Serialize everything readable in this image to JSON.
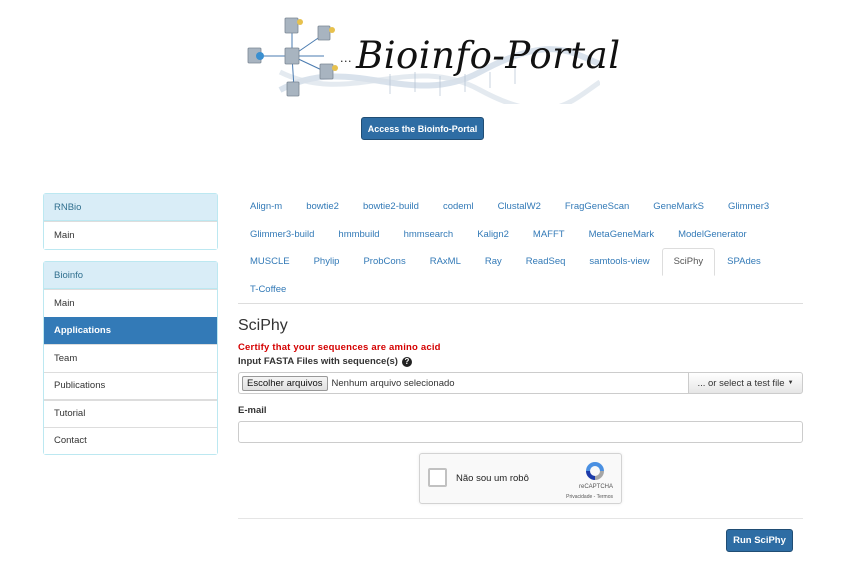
{
  "header": {
    "logo_text": "Bioinfo-Portal",
    "logo_ellipsis": "...",
    "access_button": "Access the Bioinfo-Portal"
  },
  "sidebar": {
    "rnbio": {
      "heading": "RNBio",
      "items": [
        "Main"
      ]
    },
    "bioinfo": {
      "heading": "Bioinfo",
      "items": [
        "Main",
        "Applications",
        "Team",
        "Publications",
        "Tutorial",
        "Contact"
      ],
      "active": "Applications"
    }
  },
  "tabs": [
    "Align-m",
    "bowtie2",
    "bowtie2-build",
    "codeml",
    "ClustalW2",
    "FragGeneScan",
    "GeneMarkS",
    "Glimmer3",
    "Glimmer3-build",
    "hmmbuild",
    "hmmsearch",
    "Kalign2",
    "MAFFT",
    "MetaGeneMark",
    "ModelGenerator",
    "MUSCLE",
    "Phylip",
    "ProbCons",
    "RAxML",
    "Ray",
    "ReadSeq",
    "samtools-view",
    "SciPhy",
    "SPAdes",
    "T-Coffee"
  ],
  "active_tab": "SciPhy",
  "form": {
    "title": "SciPhy",
    "warning": "Certify that your sequences are amino acid",
    "input_label": "Input FASTA Files with sequence(s)",
    "help_icon": "?",
    "file_choose": "Escolher arquivos",
    "file_none": "Nenhum arquivo selecionado",
    "test_file": "... or select a test file",
    "email_label": "E-mail",
    "email_value": "",
    "captcha_label": "Não sou um robô",
    "captcha_brand": "reCAPTCHA",
    "captcha_terms": "Privacidade - Termos",
    "run_button": "Run SciPhy"
  },
  "colors": {
    "primary": "#2e6da4",
    "link": "#337ab7",
    "panel_heading_bg": "#d9edf7",
    "warning": "#d40000"
  }
}
